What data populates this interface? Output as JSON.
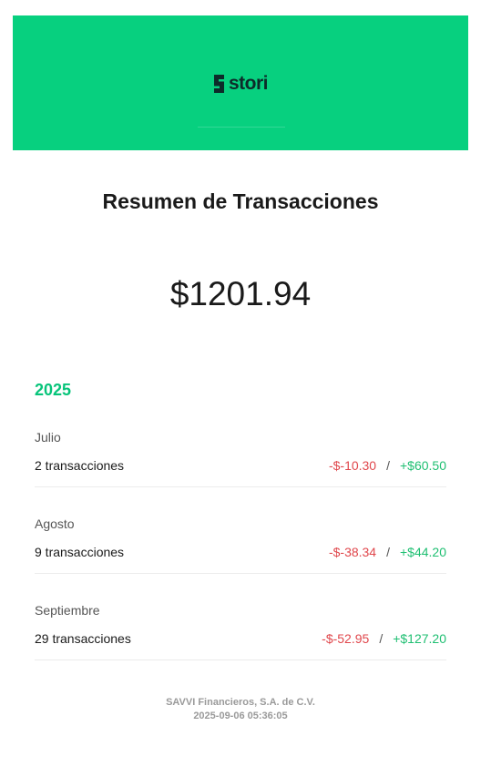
{
  "brand": {
    "logo_text": "stori",
    "accent": "#07d07f"
  },
  "title": "Resumen de Transacciones",
  "balance": "$1201.94",
  "year": "2025",
  "months": [
    {
      "name": "Julio",
      "count": "2 transacciones",
      "debit": "-$-10.30",
      "credit": "+$60.50"
    },
    {
      "name": "Agosto",
      "count": "9 transacciones",
      "debit": "-$-38.34",
      "credit": "+$44.20"
    },
    {
      "name": "Septiembre",
      "count": "29 transacciones",
      "debit": "-$-52.95",
      "credit": "+$127.20"
    }
  ],
  "separator": "/",
  "footer": {
    "company": "SAVVI Financieros, S.A. de C.V.",
    "timestamp": "2025-09-06 05:36:05"
  },
  "colors": {
    "negative": "#e0474c",
    "positive": "#1fbf72",
    "year": "#07c47a"
  }
}
